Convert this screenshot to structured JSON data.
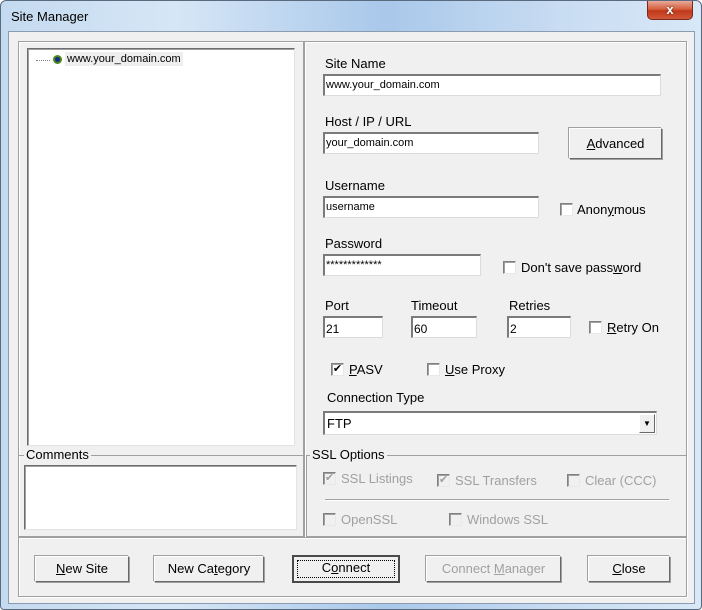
{
  "window": {
    "title": "Site Manager",
    "close_glyph": "x"
  },
  "tree": {
    "items": [
      {
        "label": "www.your_domain.com",
        "icon": "site-node-icon",
        "selected": true
      }
    ]
  },
  "comments": {
    "legend": "Comments",
    "value": ""
  },
  "site_name": {
    "label": "Site Name",
    "value": "www.your_domain.com"
  },
  "host": {
    "label": "Host / IP / URL",
    "value": "your_domain.com"
  },
  "advanced_button": {
    "pre": "",
    "accel": "A",
    "post": "dvanced"
  },
  "username": {
    "label": "Username",
    "value": "username"
  },
  "anonymous": {
    "pre": "Anon",
    "accel": "y",
    "post": "mous",
    "checked": false
  },
  "password": {
    "label": "Password",
    "value": "*************"
  },
  "dont_save_password": {
    "pre": "Don't save pass",
    "accel": "w",
    "post": "ord",
    "checked": false
  },
  "port": {
    "label": "Port",
    "value": "21"
  },
  "timeout": {
    "label": "Timeout",
    "value": "60"
  },
  "retries": {
    "label": "Retries",
    "value": "2"
  },
  "retry_on": {
    "pre": "",
    "accel": "R",
    "post": "etry On",
    "checked": false
  },
  "pasv": {
    "pre": "",
    "accel": "P",
    "post": "ASV",
    "checked": true,
    "check_glyph": "✔"
  },
  "use_proxy": {
    "pre": "",
    "accel": "U",
    "post": "se Proxy",
    "checked": false
  },
  "connection_type": {
    "label": "Connection Type",
    "value": "FTP",
    "arrow": "▼"
  },
  "ssl_options": {
    "legend": "SSL Options",
    "ssl_listings": {
      "label": "SSL Listings",
      "checked": true,
      "disabled": true
    },
    "ssl_transfers": {
      "label": "SSL Transfers",
      "checked": true,
      "disabled": true
    },
    "clear_ccc": {
      "label": "Clear (CCC)",
      "checked": false,
      "disabled": true
    },
    "openssl": {
      "label": "OpenSSL",
      "checked": false,
      "disabled": true
    },
    "windows_ssl": {
      "label": "Windows SSL",
      "checked": false,
      "disabled": true
    },
    "check_glyph": "✔"
  },
  "buttons": {
    "new_site": {
      "pre": "",
      "accel": "N",
      "post": "ew Site"
    },
    "new_category": {
      "pre": "New Ca",
      "accel": "t",
      "post": "egory"
    },
    "connect": {
      "pre": "C",
      "accel": "o",
      "post": "nnect"
    },
    "connect_manager": {
      "pre": "Connect ",
      "accel": "M",
      "post": "anager",
      "disabled": true
    },
    "close": {
      "pre": "",
      "accel": "C",
      "post": "lose"
    }
  }
}
